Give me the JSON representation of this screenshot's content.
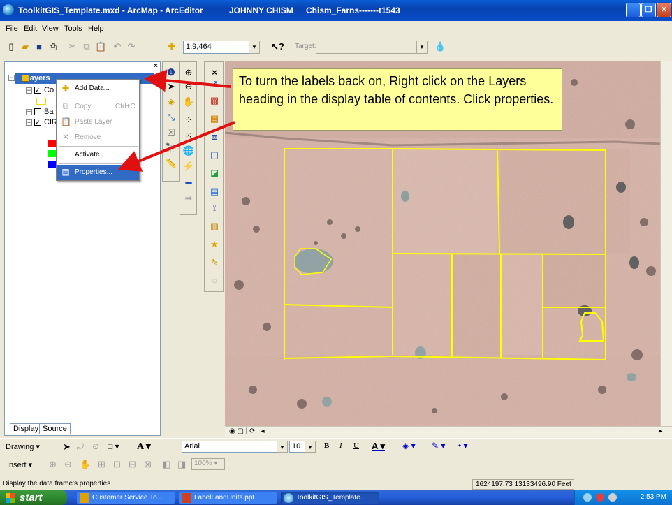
{
  "window": {
    "title": "ToolkitGIS_Template.mxd - ArcMap - ArcEditor",
    "user": "JOHNNY CHISM",
    "document": "Chism_Farns-------t1543"
  },
  "menu": [
    "File",
    "Edit",
    "View",
    "Tools",
    "Help"
  ],
  "toolbar": {
    "scale": "1:9,464",
    "target_label": "Target:",
    "target_value": ""
  },
  "toc": {
    "root_label": "Layers",
    "layers": [
      {
        "label": "Co",
        "checked": true
      },
      {
        "label": "Ba",
        "checked": false
      },
      {
        "label": "CIR",
        "checked": true
      }
    ],
    "swatches": [
      "#ff0000",
      "#00ff00",
      "#0000ff"
    ],
    "tabs": [
      "Display",
      "Source"
    ]
  },
  "context_menu": {
    "items": [
      {
        "label": "Add Data...",
        "icon": "add-data-icon",
        "enabled": true
      },
      {
        "label": "Copy",
        "shortcut": "Ctrl+C",
        "icon": "copy-icon",
        "enabled": false
      },
      {
        "label": "Paste Layer",
        "icon": "paste-icon",
        "enabled": false
      },
      {
        "label": "Remove",
        "icon": "remove-icon",
        "enabled": false
      },
      {
        "label": "Activate",
        "enabled": true
      },
      {
        "label": "Properties...",
        "icon": "properties-icon",
        "enabled": true,
        "selected": true
      }
    ]
  },
  "annotation": {
    "text": "To turn the labels back on, Right click on the Layers heading in the display table of contents. Click properties."
  },
  "drawing_toolbar": {
    "drawing_label": "Drawing",
    "font": "Arial",
    "font_size": "10",
    "insert_label": "Insert",
    "zoom": "100%"
  },
  "status": {
    "message": "Display the data frame's properties",
    "coordinates": "1624197.73  13133496.90 Feet"
  },
  "taskbar": {
    "start": "start",
    "tasks": [
      "Customer Service To...",
      "LabelLandUnits.ppt",
      "ToolkitGIS_Template...."
    ],
    "time": "2:53 PM"
  },
  "colors": {
    "parcel_outline": "#ffff00",
    "arrow": "#e01010",
    "callout_bg": "#ffff99",
    "selection": "#316ac5"
  }
}
